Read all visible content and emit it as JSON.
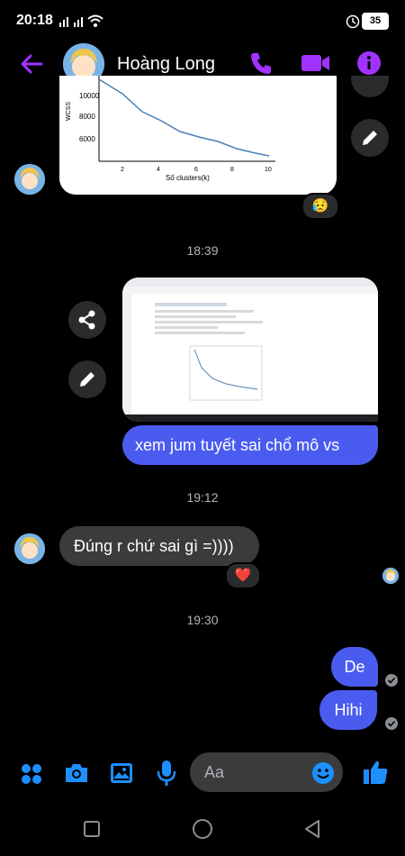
{
  "status_bar": {
    "time": "20:18",
    "battery": "35"
  },
  "header": {
    "contact_name": "Hoàng Long"
  },
  "chart_image": {
    "ylabel": "WCSS",
    "xlabel": "Số clusters(k)",
    "yticks": [
      "10000",
      "8000",
      "6000"
    ],
    "xticks": [
      "2",
      "4",
      "6",
      "8",
      "10"
    ]
  },
  "reactions": {
    "first": "😥",
    "second": "❤️"
  },
  "messages": {
    "ts1": "18:39",
    "out1": "xem jum tuyết sai chổ mô vs",
    "ts2": "19:12",
    "in1": "Đúng r chứ sai gì =))))",
    "ts3": "19:30",
    "out2": "De",
    "out3": "Hihi"
  },
  "composer": {
    "placeholder": "Aa"
  },
  "colors": {
    "accent": "#a033ff",
    "send_blue": "#4a5cf0",
    "icon_blue": "#1e8fff"
  }
}
